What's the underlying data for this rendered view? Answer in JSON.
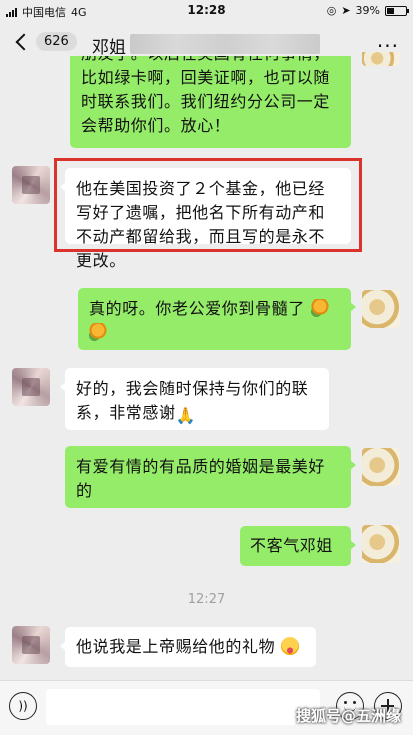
{
  "status_bar": {
    "carrier": "中国电信",
    "network": "4G",
    "time": "12:28",
    "battery": "39%",
    "battery_level": 0.39
  },
  "nav": {
    "unread_count": "626",
    "title": "邓姐",
    "more": "···"
  },
  "messages": [
    {
      "side": "right",
      "text": "朋友了。以后在美国有任何事情，比如绿卡啊，回美证啊，也可以随时联系我们。我们纽约分公司一定会帮助你们。放心！"
    },
    {
      "side": "left",
      "text": "他在美国投资了２个基金，他已经写好了遗嘱，把他名下所有动产和不动产都留给我，而且写的是永不更改。"
    },
    {
      "side": "right",
      "text": "真的呀。你老公爱你到骨髓了"
    },
    {
      "side": "left",
      "text": "好的，我会随时保持与你们的联系，非常感谢"
    },
    {
      "side": "right",
      "text": "有爱有情的有品质的婚姻是最美好的"
    },
    {
      "side": "right",
      "text": "不客气邓姐"
    },
    {
      "side": "left",
      "text": "他说我是上帝赐给他的礼物"
    }
  ],
  "timestamp": "12:27",
  "input": {
    "placeholder": ""
  },
  "watermark": "搜狐号@五洲缘",
  "colors": {
    "green_bubble": "#95ec69",
    "white_bubble": "#ffffff",
    "background": "#ededed",
    "highlight": "#d9332b"
  },
  "icons": [
    "back-chevron-icon",
    "more-icon",
    "voice-icon",
    "emoji-icon",
    "plus-icon",
    "rose-emoji",
    "pray-emoji",
    "tongue-emoji"
  ]
}
